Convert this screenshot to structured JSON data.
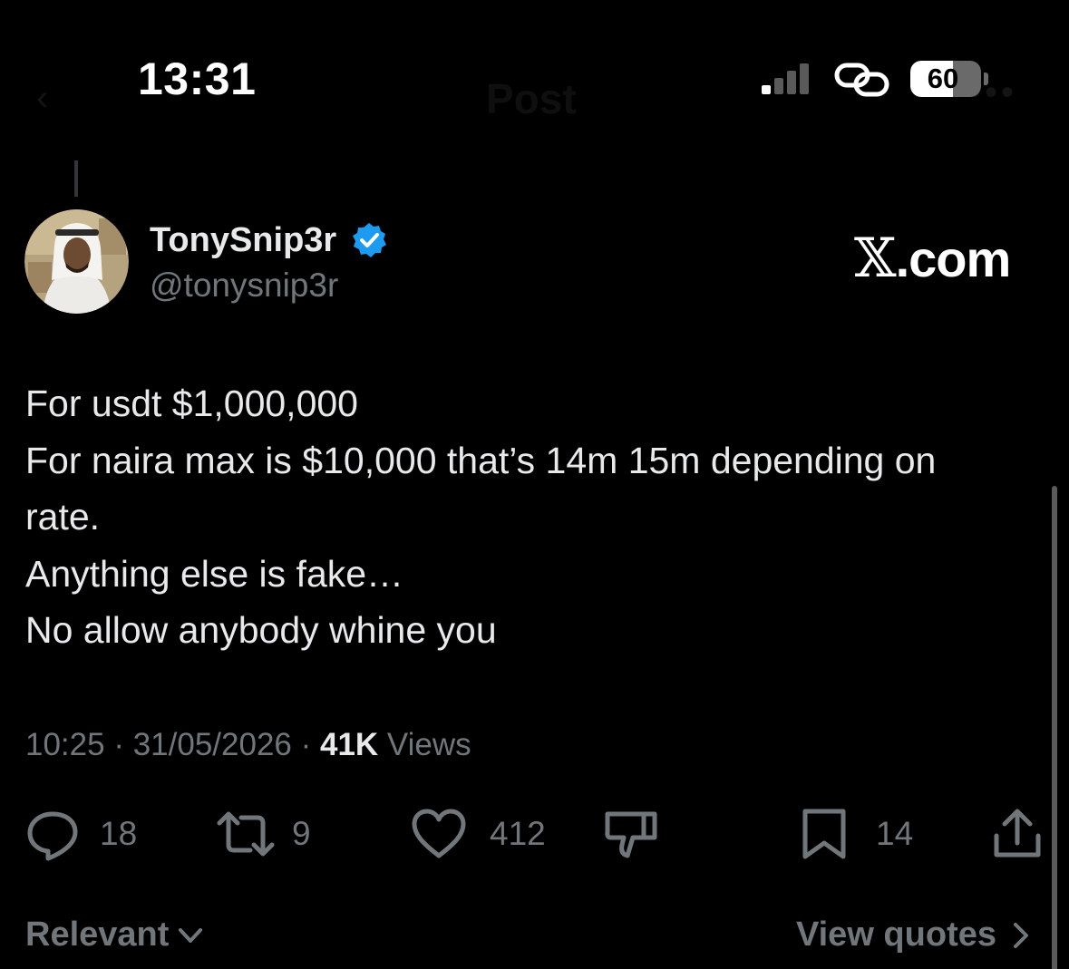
{
  "status_bar": {
    "time": "13:31",
    "signal_bars_active": 1,
    "signal_bars_total": 4,
    "battery_percent": 60,
    "battery_label": "60"
  },
  "nav": {
    "back_glyph": "‹",
    "title": "Post",
    "more_glyph": "•••"
  },
  "author": {
    "display_name": "TonySnip3r",
    "handle": "@tonysnip3r",
    "verified": true
  },
  "source_watermark": {
    "x_glyph": "𝕏",
    "suffix": ".com"
  },
  "tweet": {
    "lines": [
      "For usdt $1,000,000",
      "For naira max is $10,000 that’s 14m 15m depending on",
      "rate.",
      "Anything else is fake…",
      "No allow anybody whine you"
    ]
  },
  "meta": {
    "time": "10:25",
    "separator": " · ",
    "date": "31/05/2026",
    "views_count": "41K",
    "views_label": " Views"
  },
  "actions": {
    "replies": "18",
    "reposts": "9",
    "likes": "412",
    "bookmarks": "14"
  },
  "footer": {
    "sort_label": "Relevant",
    "sort_chevron": "⌄",
    "quotes_label": "View quotes",
    "quotes_chevron": "›"
  },
  "colors": {
    "background": "#000000",
    "primary_text": "#e7e9ea",
    "secondary_text": "#71767b",
    "verified_blue": "#1d9bf0"
  },
  "icons": [
    "reply-icon",
    "repost-icon",
    "like-icon",
    "dislike-icon",
    "bookmark-icon",
    "share-icon",
    "verified-badge-icon",
    "link-icon",
    "signal-icon",
    "battery-icon",
    "chevron-down-icon",
    "chevron-right-icon"
  ]
}
